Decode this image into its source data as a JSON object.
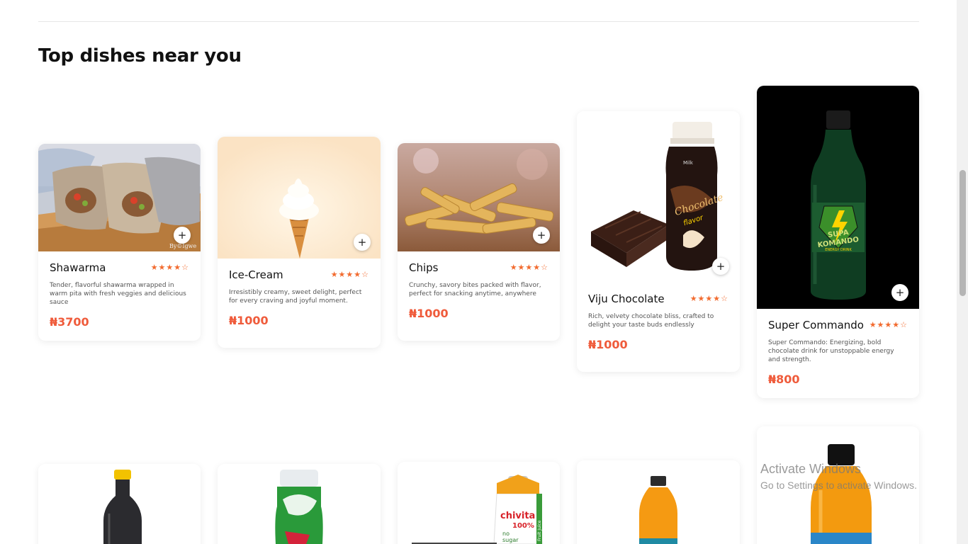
{
  "section": {
    "title": "Top dishes near you"
  },
  "dishes": [
    {
      "name": "Shawarma",
      "stars": "★★★★☆",
      "desc": "Tender, flavorful shawarma wrapped in warm pita with fresh veggies and delicious sauce",
      "price": "₦3700",
      "image": "shawarma-image"
    },
    {
      "name": "Ice-Cream",
      "stars": "★★★★☆",
      "desc": "Irresistibly creamy, sweet delight, perfect for every craving and joyful moment.",
      "price": "₦1000",
      "image": "ice-cream-image"
    },
    {
      "name": "Chips",
      "stars": "★★★★☆",
      "desc": "Crunchy, savory bites packed with flavor, perfect for snacking anytime, anywhere",
      "price": "₦1000",
      "image": "chips-image"
    },
    {
      "name": "Viju Chocolate",
      "stars": "★★★★☆",
      "desc": "Rich, velvety chocolate bliss, crafted to delight your taste buds endlessly",
      "price": "₦1000",
      "image": "chocolate-milk-image"
    },
    {
      "name": "Super Commando",
      "stars": "★★★★☆",
      "desc": "Super Commando: Energizing, bold chocolate drink for unstoppable energy and strength.",
      "price": "₦800",
      "image": "energy-drink-image"
    }
  ],
  "product_labels": {
    "chocolate_bottle_top": "Milk",
    "chocolate_bottle": "Chocolate",
    "chocolate_bottle_sub": "flavor",
    "supa_line1": "SUPA",
    "supa_line2": "KOMANDO",
    "supa_line3": "ENERGY DRINK",
    "chivita_brand": "chivita",
    "chivita_pct": "100%",
    "chivita_no": "no",
    "chivita_sugar": "sugar",
    "chivita_juice": "Fruit Juice",
    "watermark": "By©Igwe"
  },
  "watermark": {
    "line1": "Activate Windows",
    "line2": "Go to Settings to activate Windows."
  },
  "colors": {
    "accent": "#ef5b3b",
    "stars": "#f26b2f"
  }
}
